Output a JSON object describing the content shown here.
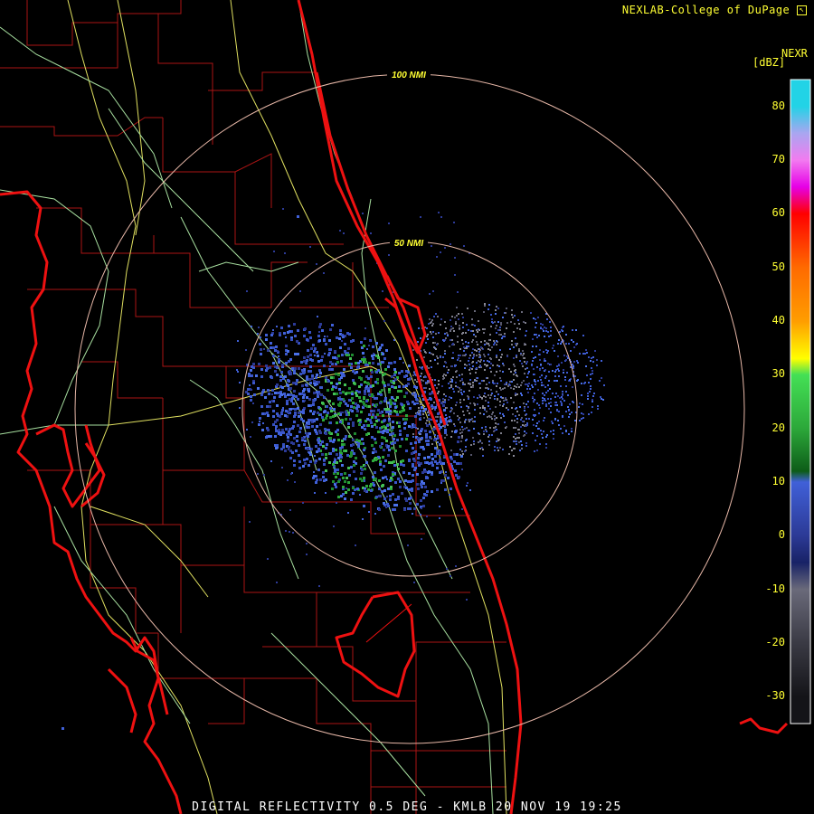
{
  "attribution": "NEXLAB-College of DuPage",
  "product_code": "NEXR",
  "legend": {
    "unit": "[dBZ]",
    "ticks": [
      "80",
      "70",
      "60",
      "50",
      "40",
      "30",
      "20",
      "10",
      "0",
      "-10",
      "-20",
      "-30"
    ],
    "color_stops": [
      {
        "dbz": 80,
        "color": "#22d3e6"
      },
      {
        "dbz": 75,
        "color": "#a9a6f0"
      },
      {
        "dbz": 70,
        "color": "#f27bf0"
      },
      {
        "dbz": 65,
        "color": "#e600e6"
      },
      {
        "dbz": 60,
        "color": "#ff0000"
      },
      {
        "dbz": 50,
        "color": "#ff6a00"
      },
      {
        "dbz": 40,
        "color": "#ff9d00"
      },
      {
        "dbz": 33,
        "color": "#ffff00"
      },
      {
        "dbz": 30,
        "color": "#44e055"
      },
      {
        "dbz": 20,
        "color": "#2ca83a"
      },
      {
        "dbz": 12,
        "color": "#0d5c18"
      },
      {
        "dbz": 10,
        "color": "#4060d8"
      },
      {
        "dbz": 0,
        "color": "#2c3a96"
      },
      {
        "dbz": -5,
        "color": "#182266"
      },
      {
        "dbz": -10,
        "color": "#6a6a7a"
      },
      {
        "dbz": -20,
        "color": "#3a3a44"
      },
      {
        "dbz": -30,
        "color": "#141418"
      }
    ]
  },
  "range_rings": [
    {
      "label": "100 NMI",
      "nmi": 100
    },
    {
      "label": "50 NMI",
      "nmi": 50
    }
  ],
  "footer": "DIGITAL REFLECTIVITY 0.5 DEG - KMLB 20 NOV 19 19:25",
  "colors": {
    "coast": "#ee1111",
    "county": "#aa1515",
    "roads_major": "#e0e060",
    "roads_minor": "#a8e0a0",
    "ring": "#e8b8a8",
    "ring_label": "#ffff33"
  }
}
